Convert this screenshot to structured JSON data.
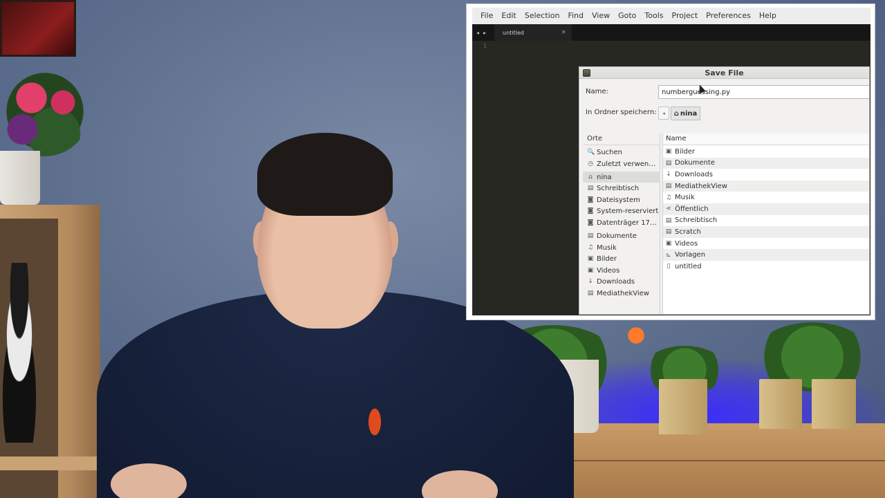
{
  "menubar": {
    "items": [
      "File",
      "Edit",
      "Selection",
      "Find",
      "View",
      "Goto",
      "Tools",
      "Project",
      "Preferences",
      "Help"
    ]
  },
  "tab": {
    "label": "untitled",
    "close_glyph": "×",
    "prev_glyph": "◂",
    "next_glyph": "▸"
  },
  "editor": {
    "line_number": "1",
    "colors": {
      "background": "#272822",
      "gutter_text": "#75715e"
    }
  },
  "dialog": {
    "title": "Save File",
    "name_label": "Name:",
    "name_value": "numberguessing.py",
    "folder_label": "In Ordner speichern:",
    "path_back_glyph": "◂",
    "path_home_icon": "home-icon",
    "path_home_label": "nina",
    "places_header": "Orte",
    "places": [
      {
        "label": "Suchen",
        "icon": "search-icon",
        "glyph": "🔍"
      },
      {
        "label": "Zuletzt verwen…",
        "icon": "recent-icon",
        "glyph": "◷"
      },
      {
        "label": "nina",
        "icon": "home-icon",
        "glyph": "⌂",
        "selected": true
      },
      {
        "label": "Schreibtisch",
        "icon": "desktop-icon",
        "glyph": "▤"
      },
      {
        "label": "Dateisystem",
        "icon": "drive-icon",
        "glyph": "◙"
      },
      {
        "label": "System-reserviert",
        "icon": "drive-icon",
        "glyph": "◙"
      },
      {
        "label": "Datenträger 17…",
        "icon": "drive-icon",
        "glyph": "◙"
      },
      {
        "label": "Dokumente",
        "icon": "folder-icon",
        "glyph": "▤"
      },
      {
        "label": "Musik",
        "icon": "music-icon",
        "glyph": "♫"
      },
      {
        "label": "Bilder",
        "icon": "pictures-icon",
        "glyph": "▣"
      },
      {
        "label": "Videos",
        "icon": "video-icon",
        "glyph": "▣"
      },
      {
        "label": "Downloads",
        "icon": "download-icon",
        "glyph": "↓"
      },
      {
        "label": "MediathekView",
        "icon": "folder-icon",
        "glyph": "▤"
      }
    ],
    "files_header": "Name",
    "files": [
      {
        "label": "Bilder",
        "icon": "pictures-folder-icon",
        "glyph": "▣"
      },
      {
        "label": "Dokumente",
        "icon": "folder-icon",
        "glyph": "▤"
      },
      {
        "label": "Downloads",
        "icon": "download-icon",
        "glyph": "↓"
      },
      {
        "label": "MediathekView",
        "icon": "folder-icon",
        "glyph": "▤"
      },
      {
        "label": "Musik",
        "icon": "music-icon",
        "glyph": "♫"
      },
      {
        "label": "Öffentlich",
        "icon": "share-icon",
        "glyph": "⋖"
      },
      {
        "label": "Schreibtisch",
        "icon": "folder-icon",
        "glyph": "▤"
      },
      {
        "label": "Scratch",
        "icon": "folder-icon",
        "glyph": "▤"
      },
      {
        "label": "Videos",
        "icon": "video-icon",
        "glyph": "▣"
      },
      {
        "label": "Vorlagen",
        "icon": "templates-icon",
        "glyph": "⊾"
      },
      {
        "label": "untitled",
        "icon": "file-icon",
        "glyph": "▯"
      }
    ]
  }
}
